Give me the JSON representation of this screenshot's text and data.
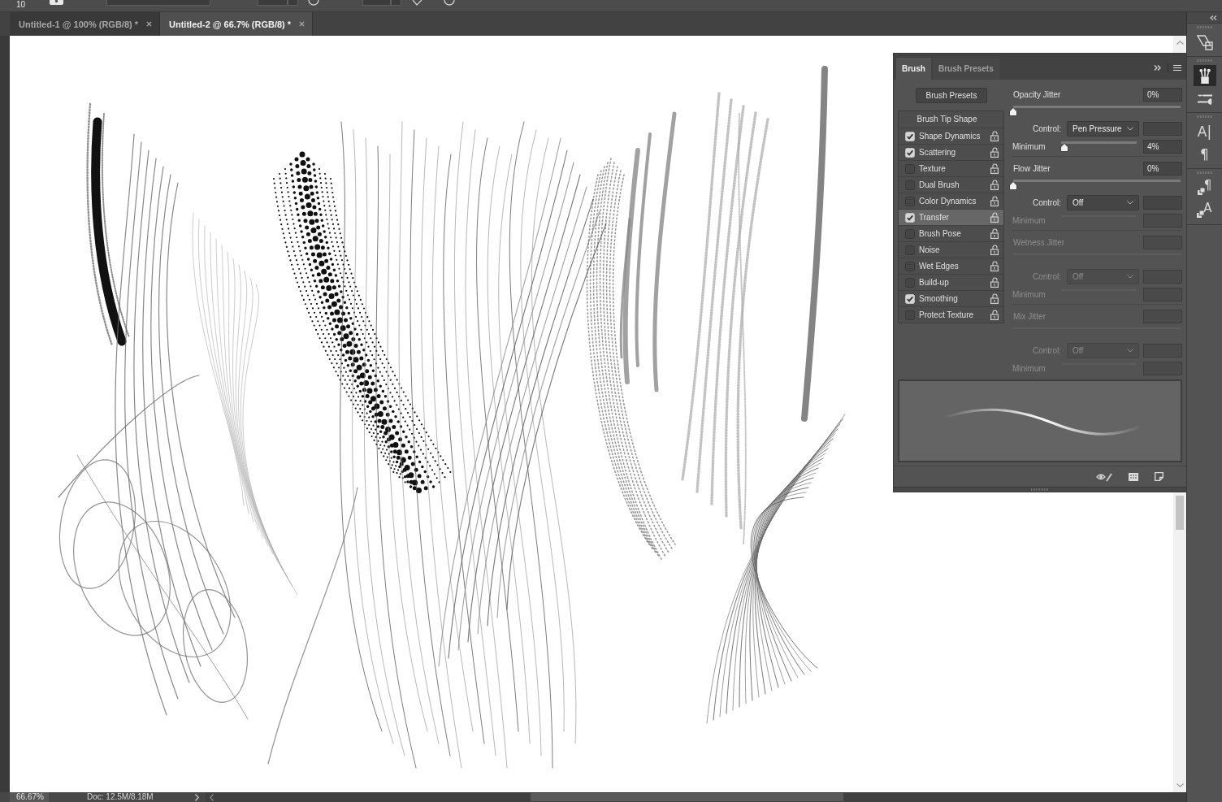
{
  "options_bar": {
    "brush_size": "10"
  },
  "document_tabs": [
    {
      "title": "Untitled-1 @ 100% (RGB/8) *",
      "selected": false
    },
    {
      "title": "Untitled-2 @ 66.7% (RGB/8) *",
      "selected": true
    }
  ],
  "brush_panel": {
    "tabs": [
      {
        "label": "Brush",
        "selected": true
      },
      {
        "label": "Brush Presets",
        "selected": false
      }
    ],
    "presets_button": "Brush Presets",
    "tip_shape": "Brush Tip Shape",
    "options": [
      {
        "label": "Shape Dynamics",
        "checked": true,
        "selected": false
      },
      {
        "label": "Scattering",
        "checked": true,
        "selected": false
      },
      {
        "label": "Texture",
        "checked": false,
        "selected": false
      },
      {
        "label": "Dual Brush",
        "checked": false,
        "selected": false
      },
      {
        "label": "Color Dynamics",
        "checked": false,
        "selected": false
      },
      {
        "label": "Transfer",
        "checked": true,
        "selected": true
      },
      {
        "label": "Brush Pose",
        "checked": false,
        "selected": false
      },
      {
        "label": "Noise",
        "checked": false,
        "selected": false
      },
      {
        "label": "Wet Edges",
        "checked": false,
        "selected": false
      },
      {
        "label": "Build-up",
        "checked": false,
        "selected": false
      },
      {
        "label": "Smoothing",
        "checked": true,
        "selected": false
      },
      {
        "label": "Protect Texture",
        "checked": false,
        "selected": false
      }
    ],
    "settings": [
      {
        "label": "Opacity Jitter",
        "value": "0%",
        "level": 0,
        "disabled": false,
        "control": {
          "label": "Control:",
          "value": "Pen Pressure",
          "disabled": false
        },
        "minimum": {
          "label": "Minimum",
          "value": "4%",
          "level": 0.04,
          "disabled": false
        }
      },
      {
        "label": "Flow Jitter",
        "value": "0%",
        "level": 0,
        "disabled": false,
        "control": {
          "label": "Control:",
          "value": "Off",
          "disabled": false
        },
        "minimum": {
          "label": "Minimum",
          "disabled": true
        }
      },
      {
        "label": "Wetness Jitter",
        "disabled": true,
        "control": {
          "label": "Control:",
          "value": "Off",
          "disabled": true
        },
        "minimum": {
          "label": "Minimum",
          "disabled": true
        }
      },
      {
        "label": "Mix Jitter",
        "disabled": true,
        "control": {
          "label": "Control:",
          "value": "Off",
          "disabled": true
        },
        "minimum": {
          "label": "Minimum",
          "disabled": true
        }
      }
    ]
  },
  "dock": [
    {
      "items": [
        {
          "kind": "clone",
          "selected": false
        }
      ]
    },
    {
      "items": [
        {
          "kind": "brushes",
          "selected": true
        },
        {
          "kind": "sliders",
          "selected": false
        }
      ]
    },
    {
      "items": [
        {
          "kind": "glyph",
          "glyph": "A|",
          "selected": false
        },
        {
          "kind": "glyph",
          "glyph": "¶",
          "selected": false
        }
      ]
    },
    {
      "items": [
        {
          "kind": "styles",
          "glyph": "¶",
          "selected": false
        },
        {
          "kind": "styles",
          "glyph": "A",
          "selected": false
        }
      ]
    }
  ],
  "status_bar": {
    "zoom": "66.67%",
    "doc_info": "Doc: 12.5M/8.18M"
  }
}
